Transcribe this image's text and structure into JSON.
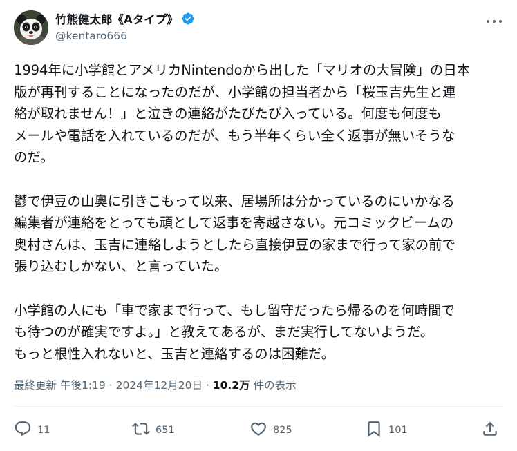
{
  "author": {
    "display_name": "竹熊健太郎《Aタイプ》",
    "handle": "@kentaro666",
    "verified": true,
    "verified_color": "#1d9bf0",
    "avatar_icon": "panda-avatar-icon"
  },
  "tweet": {
    "paragraphs": [
      [
        "1994年に小学館とアメリカNintendoから出した「マリオの大冒険」の日本",
        "版が再刊することになったのだが、小学館の担当者から「桜玉吉先生と連",
        "絡が取れません！」と泣きの連絡がたびたび入っている。何度も何度も",
        "メールや電話を入れているのだが、もう半年くらい全く返事が無いそうな",
        "のだ。"
      ],
      [
        "鬱で伊豆の山奥に引きこもって以来、居場所は分かっているのにいかなる",
        "編集者が連絡をとっても頑として返事を寄越さない。元コミックビームの",
        "奥村さんは、玉吉に連絡しようとしたら直接伊豆の家まで行って家の前で",
        "張り込むしかない、と言っていた。"
      ],
      [
        "小学館の人にも「車で家まで行って、もし留守だったら帰るのを何時間で",
        "も待つのが確実ですよ。」と教えてあるが、まだ実行してないようだ。",
        "もっと根性入れないと、玉吉と連絡するのは困難だ。"
      ]
    ],
    "meta": {
      "updated_label": "最終更新",
      "time": "午後1:19",
      "separator": "·",
      "date": "2024年12月20日",
      "views_count": "10.2万",
      "views_label": "件の表示"
    }
  },
  "actions": {
    "replies": "11",
    "retweets": "651",
    "likes": "825",
    "bookmarks": "101"
  },
  "colors": {
    "text": "#0f1419",
    "secondary": "#536471",
    "divider": "#eff3f4"
  }
}
